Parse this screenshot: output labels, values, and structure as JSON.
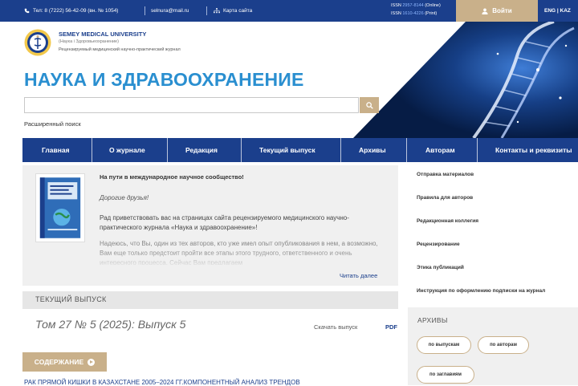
{
  "topbar": {
    "phone": "Тел: 8 (7222) 56-42-09 (вн. № 1054)",
    "email": "selnura@mail.ru",
    "sitemap": "Карта сайта",
    "issn_online_label": "ISSN",
    "issn_online_num": "2957-8144",
    "issn_online_type": "(Online)",
    "issn_print_label": "ISSN",
    "issn_print_num": "1610-4226",
    "issn_print_type": "(Print)",
    "login": "Войти",
    "lang": "ENG | KAZ"
  },
  "brand": {
    "university": "SEMEY MEDICAL UNIVERSITY",
    "subtitle": "(Наука і Здоровьеохранение)",
    "description": "Рецензируемый медицинский научно-практический журнал",
    "title": "НАУКА И ЗДРАВООХРАНЕНИЕ"
  },
  "search": {
    "placeholder": "",
    "advanced": "Расширенный поиск"
  },
  "nav": {
    "items": [
      "Главная",
      "О журнале",
      "Редакция",
      "Текущий выпуск",
      "Архивы",
      "Авторам",
      "Контакты и реквизиты"
    ]
  },
  "welcome": {
    "title": "На пути в международное научное сообщество!",
    "greeting": "Дорогие друзья!",
    "paragraph1": "Рад приветствовать вас на страницах сайта рецензируемого медицинского научно-практического журнала «Наука и здравоохранение»!",
    "paragraph2": "Надеюсь, что Вы, один из тех авторов, кто уже имел опыт опубликования в нем, а возможно, Вам еще только предстоит пройти все этапы этого трудного, ответственного и очень интересного процесса. Сейчас Вам предлагаем",
    "read_more": "Читать далее"
  },
  "sidebar": {
    "items": [
      "Отправка материалов",
      "Правила для авторов",
      "Редакционная коллегия",
      "Рецензирование",
      "Этика публикаций",
      "Инструкция по оформлению подписки на журнал"
    ]
  },
  "current": {
    "label": "ТЕКУЩИЙ ВЫПУСК",
    "issue": "Том 27 № 5 (2025): Выпуск 5",
    "download": "Скачать выпуск",
    "pdf": "PDF",
    "contents": "СОДЕРЖАНИЕ",
    "article": "РАК ПРЯМОЙ КИШКИ В КАЗАХСТАНЕ 2005–2024 ГГ.КОМПОНЕНТНЫЙ АНАЛИЗ ТРЕНДОВ"
  },
  "archives": {
    "title": "АРХИВЫ",
    "buttons": [
      "по выпускам",
      "по авторам",
      "по заглавиям"
    ]
  },
  "colors": {
    "navy": "#1b3f8c",
    "gold": "#c9b08a",
    "title_blue": "#2a8fd0"
  }
}
